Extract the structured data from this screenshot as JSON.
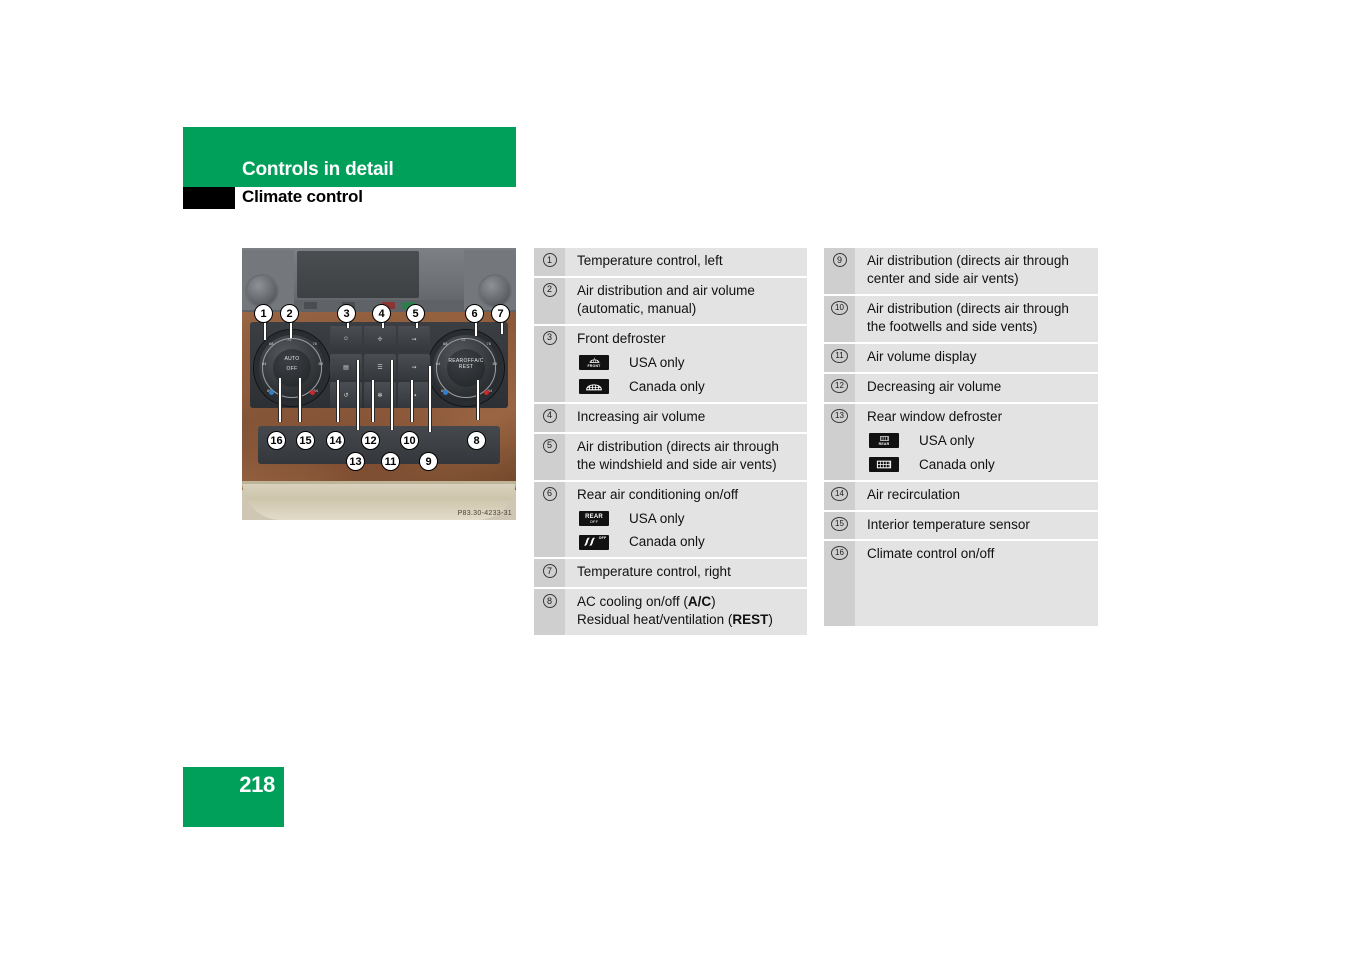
{
  "header": {
    "section_title": "Controls in detail",
    "page_title": "Climate control"
  },
  "figure": {
    "caption": "P83.30-4233-31",
    "left_knob": {
      "center_top": "AUTO",
      "center_bottom": "OFF",
      "ticks": [
        "60",
        "64",
        "68",
        "72",
        "76",
        "80",
        "84"
      ]
    },
    "right_knob": {
      "center_top": "REAR",
      "center_top_sub": "OFF",
      "center_bottom": "A/C",
      "center_bottom_sub": "REST",
      "ticks": [
        "60",
        "64",
        "68",
        "72",
        "76",
        "80",
        "84"
      ]
    },
    "callouts": [
      "1",
      "2",
      "3",
      "4",
      "5",
      "6",
      "7",
      "8",
      "9",
      "10",
      "11",
      "12",
      "13",
      "14",
      "15",
      "16"
    ]
  },
  "legend": {
    "column1": [
      {
        "num": "1",
        "lines": [
          "Temperature control, left"
        ],
        "variants": []
      },
      {
        "num": "2",
        "lines": [
          "Air distribution and air volume",
          "(automatic, manual)"
        ],
        "variants": []
      },
      {
        "num": "3",
        "lines": [
          "Front defroster"
        ],
        "variants": [
          {
            "icon": "front-defroster-usa-icon",
            "badge_text": "FRONT",
            "label": "USA only"
          },
          {
            "icon": "front-defroster-canada-icon",
            "badge_text": "",
            "label": "Canada only"
          }
        ]
      },
      {
        "num": "4",
        "lines": [
          "Increasing air volume"
        ],
        "variants": []
      },
      {
        "num": "5",
        "lines": [
          "Air distribution (directs air through",
          "the windshield and side air vents)"
        ],
        "variants": []
      },
      {
        "num": "6",
        "lines": [
          "Rear air conditioning on/off"
        ],
        "variants": [
          {
            "icon": "rear-ac-usa-icon",
            "badge_text": "REAR",
            "badge_sub": "OFF",
            "label": "USA only"
          },
          {
            "icon": "rear-ac-canada-icon",
            "badge_text": "",
            "badge_sub": "OFF",
            "label": "Canada only"
          }
        ]
      },
      {
        "num": "7",
        "lines": [
          "Temperature control, right"
        ],
        "variants": []
      },
      {
        "num": "8",
        "lines": [
          "AC cooling on/off (A/C)",
          "Residual heat/ventilation (REST)"
        ],
        "variants": []
      }
    ],
    "column2": [
      {
        "num": "9",
        "lines": [
          "Air distribution (directs air through",
          "center and side air vents)"
        ],
        "variants": []
      },
      {
        "num": "10",
        "lines": [
          "Air distribution (directs air through",
          "the footwells and side vents)"
        ],
        "variants": []
      },
      {
        "num": "11",
        "lines": [
          "Air volume display"
        ],
        "variants": []
      },
      {
        "num": "12",
        "lines": [
          "Decreasing air volume"
        ],
        "variants": []
      },
      {
        "num": "13",
        "lines": [
          "Rear window defroster"
        ],
        "variants": [
          {
            "icon": "rear-defroster-usa-icon",
            "badge_text": "REAR",
            "label": "USA only"
          },
          {
            "icon": "rear-defroster-canada-icon",
            "badge_text": "",
            "label": "Canada only"
          }
        ]
      },
      {
        "num": "14",
        "lines": [
          "Air recirculation"
        ],
        "variants": []
      },
      {
        "num": "15",
        "lines": [
          "Interior temperature sensor"
        ],
        "variants": []
      },
      {
        "num": "16",
        "lines": [
          "Climate control on/off"
        ],
        "variants": []
      }
    ]
  },
  "footer": {
    "page_number": "218"
  },
  "colors": {
    "brand_green": "#00a05a",
    "row_bg": "#e3e3e3",
    "num_col_bg": "#cfcfcf",
    "badge_bg": "#111111"
  }
}
